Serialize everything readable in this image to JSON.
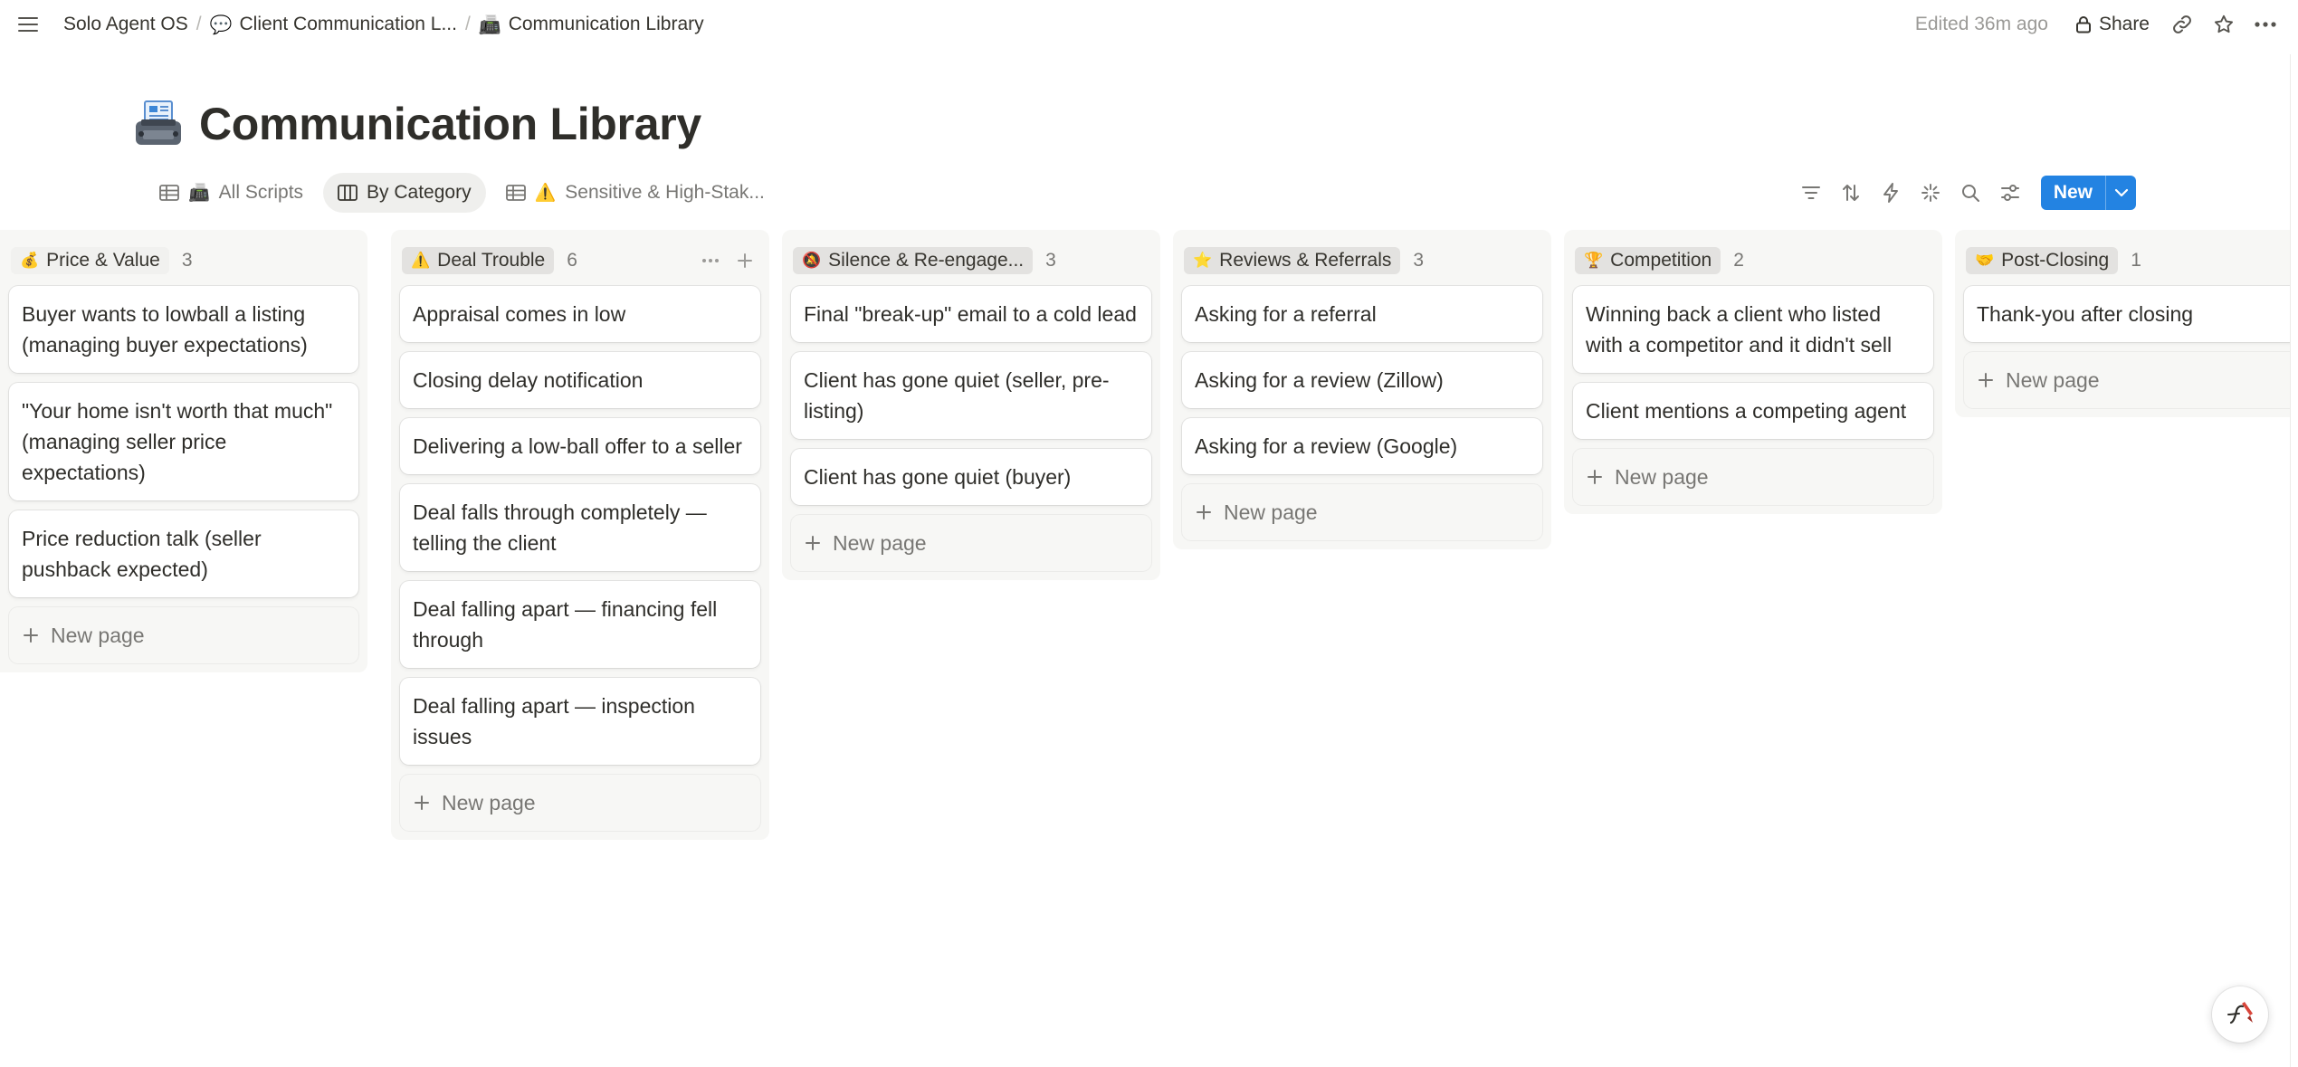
{
  "breadcrumb": {
    "items": [
      {
        "label": "Solo Agent OS",
        "emoji": ""
      },
      {
        "label": "Client Communication L...",
        "emoji": "💬"
      },
      {
        "label": "Communication Library",
        "emoji": "📠"
      }
    ],
    "separator": "/"
  },
  "topbar": {
    "edited": "Edited 36m ago",
    "share_label": "Share"
  },
  "page": {
    "title": "Communication Library",
    "icon": "fax-machine-icon"
  },
  "views": [
    {
      "label": "All Scripts",
      "emoji": "📠",
      "icon": "table-icon",
      "active": false
    },
    {
      "label": "By Category",
      "emoji": "",
      "icon": "board-icon",
      "active": true
    },
    {
      "label": "Sensitive & High-Stak...",
      "emoji": "⚠️",
      "icon": "table-icon",
      "active": false
    }
  ],
  "toolbar": {
    "new_label": "New",
    "accent": "#2383e2"
  },
  "board": {
    "new_page_label": "New page",
    "columns": [
      {
        "name": "Price & Value",
        "emoji": "💰",
        "count": "3",
        "pill_color": "#f1f1ef",
        "cards": [
          "Buyer wants to lowball a listing (managing buyer expectations)",
          "\"Your home isn't worth that much\" (managing seller price expectations)",
          "Price reduction talk (seller pushback expected)"
        ]
      },
      {
        "name": "Deal Trouble",
        "emoji": "⚠️",
        "count": "6",
        "pill_color": "#e3e2e0",
        "cards": [
          "Appraisal comes in low",
          "Closing delay notification",
          "Delivering a low-ball offer to a seller",
          "Deal falls through completely — telling the client",
          "Deal falling apart — financing fell through",
          "Deal falling apart — inspection issues"
        ]
      },
      {
        "name": "Silence & Re-engage...",
        "emoji": "🔕",
        "count": "3",
        "pill_color": "#e3e2e0",
        "cards": [
          "Final \"break-up\" email to a cold lead",
          "Client has gone quiet (seller, pre-listing)",
          "Client has gone quiet (buyer)"
        ]
      },
      {
        "name": "Reviews & Referrals",
        "emoji": "⭐",
        "count": "3",
        "pill_color": "#e3e2e0",
        "cards": [
          "Asking for a referral",
          "Asking for a review (Zillow)",
          "Asking for a review (Google)"
        ]
      },
      {
        "name": "Competition",
        "emoji": "🏆",
        "count": "2",
        "pill_color": "#e3e2e0",
        "cards": [
          "Winning back a client who listed with a competitor and it didn't sell",
          "Client mentions a competing agent"
        ]
      },
      {
        "name": "Post-Closing",
        "emoji": "🤝",
        "count": "1",
        "pill_color": "#e3e2e0",
        "cards": [
          "Thank-you after closing"
        ]
      }
    ]
  }
}
